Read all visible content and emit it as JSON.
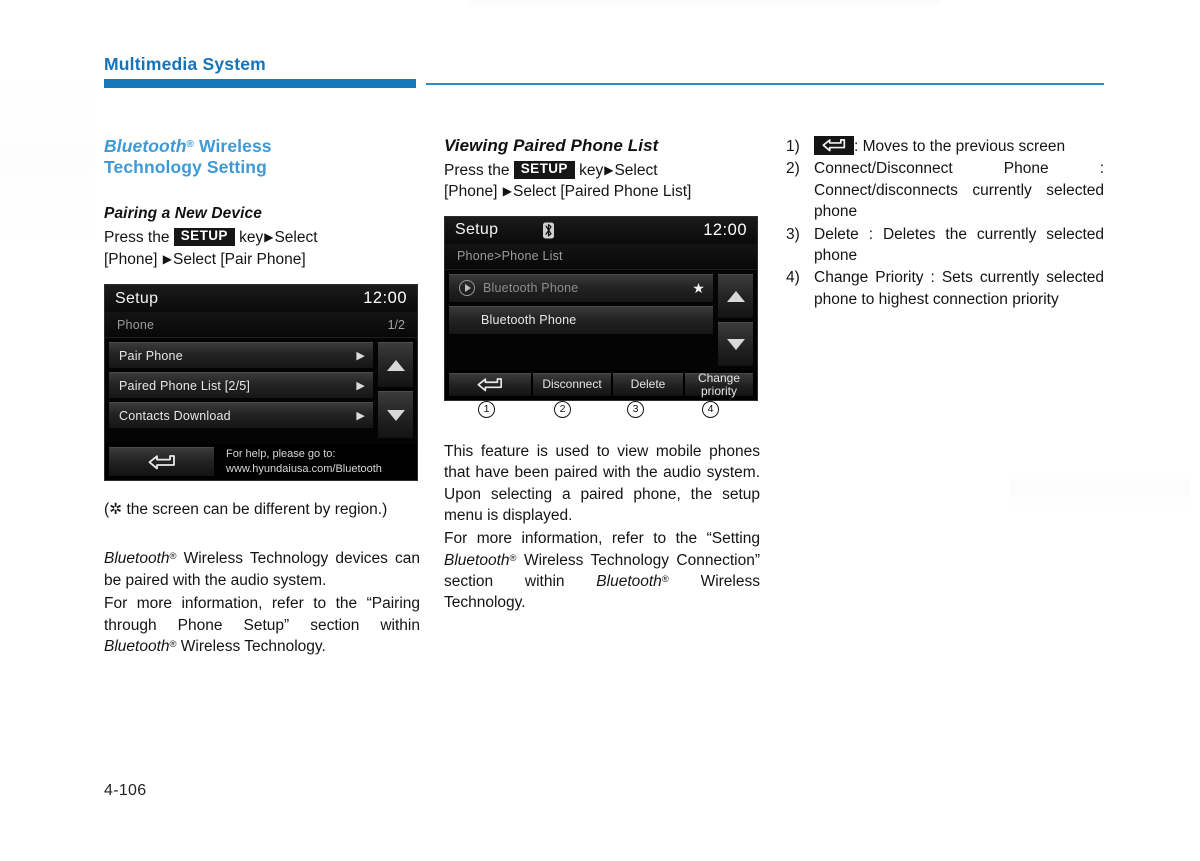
{
  "header": {
    "title": "Multimedia System",
    "rule_color": "#1379bc"
  },
  "folio": "4-106",
  "left_column": {
    "section_title_line1": "Bluetooth",
    "section_title_reg": "®",
    "section_title_line1b": " Wireless",
    "section_title_line2": "Technology Setting",
    "sub_title": "Pairing a New Device",
    "instruction_pre": "Press     the ",
    "instruction_key": "SETUP",
    "instruction_mid": " key",
    "instruction_post1": "Select",
    "instruction_post2": "[Phone] ",
    "instruction_post3": "Select [Pair Phone]",
    "region_note": "(✲ the screen can be different by region.)",
    "para1_a": "Bluetooth",
    "para1_reg": "®",
    "para1_b": " Wireless   Technology devices can be paired with the audio system.",
    "para2_a": "For more information, refer to the “Pairing through Phone Setup” section within ",
    "para2_ital": "Bluetooth",
    "para2_reg": "®",
    "para2_b": " Wireless Technology.",
    "screen": {
      "title": "Setup",
      "clock": "12:00",
      "subtitle": "Phone",
      "page_indicator": "1/2",
      "rows": [
        {
          "label": "Pair Phone",
          "caret": "▶"
        },
        {
          "label": "Paired Phone List [2/5]",
          "caret": "▶"
        },
        {
          "label": "Contacts Download",
          "caret": "▶"
        }
      ],
      "scroll_up": "▲",
      "scroll_down": "▼",
      "back_button": "back-arrow",
      "help_line1": "For help, please go to:",
      "help_line2": "www.hyundaiusa.com/Bluetooth"
    }
  },
  "mid_column": {
    "sub_title": "Viewing Paired Phone List",
    "instruction_pre": "Press     the ",
    "instruction_key": "SETUP",
    "instruction_mid": " key",
    "instruction_post1": "Select",
    "instruction_post2": "[Phone] ",
    "instruction_post3": "Select [Paired Phone List]",
    "para1": "This feature is used to view mobile phones that have been paired with the audio system. Upon selecting a paired phone, the setup menu is displayed.",
    "para2_a": "For more information, refer to the “Setting ",
    "para2_ital": "Bluetooth",
    "para2_reg": "®",
    "para2_b": " Wireless Technology Connection” section within ",
    "para2_ital2": "Bluetooth",
    "para2_reg2": "®",
    "para2_c": " Wireless Technology.",
    "screen": {
      "title": "Setup",
      "bt_icon": "bluetooth-icon",
      "clock": "12:00",
      "subtitle": "Phone>Phone List",
      "rows": [
        {
          "label": "Bluetooth Phone",
          "state": "connected",
          "star": "★"
        },
        {
          "label": "Bluetooth Phone",
          "state": "normal",
          "star": ""
        }
      ],
      "scroll_up": "▲",
      "scroll_down": "▼",
      "footer_buttons": [
        {
          "label": "",
          "icon": "back-arrow"
        },
        {
          "label": "Disconnect",
          "icon": ""
        },
        {
          "label": "Delete",
          "icon": ""
        },
        {
          "label": "Change\npriority",
          "icon": ""
        }
      ]
    },
    "callouts": [
      "①",
      "②",
      "③",
      "④"
    ]
  },
  "right_column": {
    "items": [
      {
        "num": "1)",
        "icon": "back-arrow-key",
        "text": ": Moves to the previous screen"
      },
      {
        "num": "2)",
        "text": "Connect/Disconnect   Phone   : Connect/disconnects   currently selected phone"
      },
      {
        "num": "3)",
        "text": "Delete : Deletes the currently selected phone"
      },
      {
        "num": "4)",
        "text": "Change Priority : Sets currently selected phone to highest connection priority"
      }
    ]
  }
}
